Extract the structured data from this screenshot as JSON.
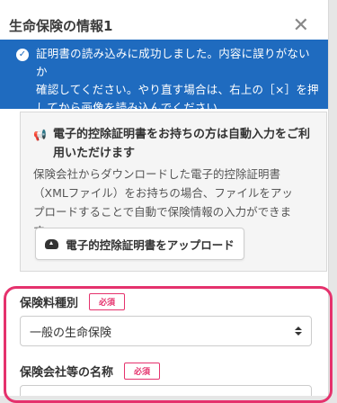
{
  "modal": {
    "title": "生命保険の情報1",
    "close_glyph": "✕"
  },
  "alert": {
    "icon": "check-circle-icon",
    "lines": [
      "証明書の読み込みに成功しました。内容に誤りがないか",
      "確認してください。やり直す場合は、右上の［×］を押",
      "してから画像を読み込んでください。"
    ],
    "color": "#1f6bbf"
  },
  "import": {
    "icon": "megaphone-icon",
    "title_lines": [
      "電子的控除証明書をお持ちの方は自動入力をご利",
      "用いただけます"
    ],
    "desc_lines": [
      "保険会社からダウンロードした電子的控除証明書",
      "（XMLファイル）をお持ちの場合、ファイルをアッ",
      "プロードすることで自動で保険情報の入力ができま",
      "す。"
    ],
    "upload_label": "電子的控除証明書をアップロード",
    "upload_icon": "cloud-upload-icon"
  },
  "form": {
    "premium_type_label": "保険料種別",
    "premium_type_required": "必須",
    "premium_type_value": "一般の生命保険",
    "company_label": "保険会社等の名称",
    "company_required": "必須"
  },
  "colors": {
    "highlight": "#e5326d",
    "required": "#e5326d"
  }
}
